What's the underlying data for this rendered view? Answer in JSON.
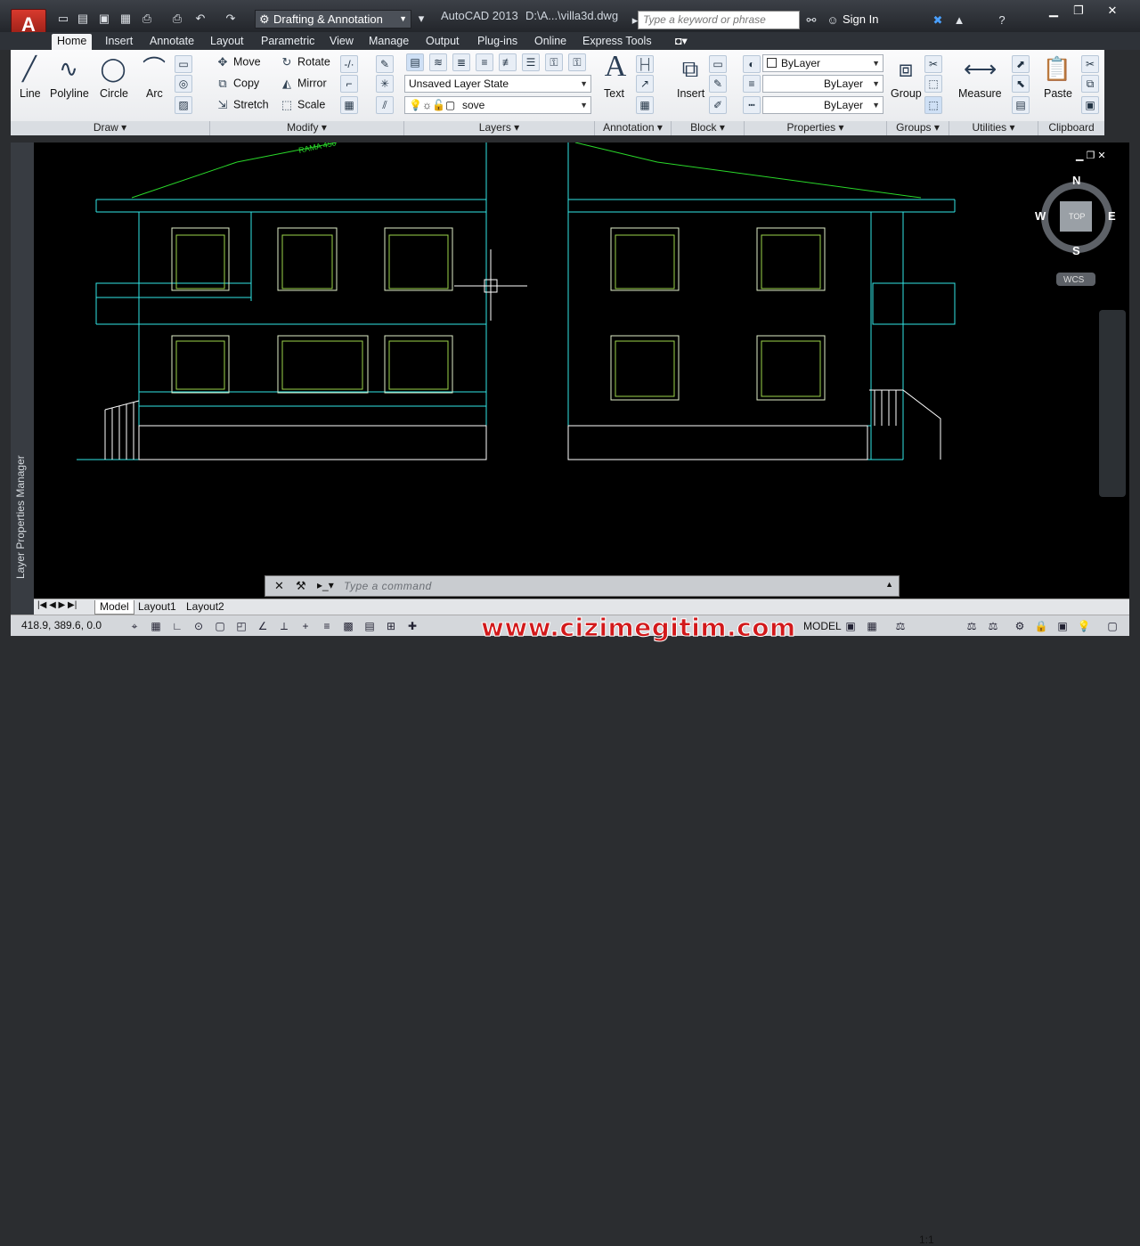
{
  "app": {
    "logo": "A",
    "title": "AutoCAD 2013",
    "file": "D:\\A...\\villa3d.dwg"
  },
  "workspace": "Drafting & Annotation",
  "search": {
    "placeholder": "Type a keyword or phrase"
  },
  "signin": "Sign In",
  "tabs": [
    "Home",
    "Insert",
    "Annotate",
    "Layout",
    "Parametric",
    "View",
    "Manage",
    "Output",
    "Plug-ins",
    "Online",
    "Express Tools"
  ],
  "draw": {
    "line": "Line",
    "polyline": "Polyline",
    "circle": "Circle",
    "arc": "Arc",
    "title": "Draw"
  },
  "modify": {
    "move": "Move",
    "rotate": "Rotate",
    "copy": "Copy",
    "mirror": "Mirror",
    "stretch": "Stretch",
    "scale": "Scale",
    "title": "Modify"
  },
  "layers": {
    "state": "Unsaved Layer State",
    "current": "sove",
    "title": "Layers"
  },
  "annotation": {
    "text": "Text",
    "title": "Annotation"
  },
  "block": {
    "insert": "Insert",
    "title": "Block"
  },
  "properties": {
    "color": "ByLayer",
    "linetype": "ByLayer",
    "lineweight": "ByLayer",
    "title": "Properties"
  },
  "groups": {
    "group": "Group",
    "title": "Groups"
  },
  "utilities": {
    "measure": "Measure",
    "title": "Utilities"
  },
  "clipboard": {
    "paste": "Paste",
    "title": "Clipboard"
  },
  "sidepalette": "Layer Properties Manager",
  "viewcube": {
    "n": "N",
    "s": "S",
    "e": "E",
    "w": "W",
    "top": "TOP",
    "wcs": "WCS"
  },
  "command": {
    "placeholder": "Type a command"
  },
  "layouts": [
    "Model",
    "Layout1",
    "Layout2"
  ],
  "status": {
    "coords": "418.9, 389.6, 0.0",
    "model": "MODEL",
    "scale": "1:1"
  },
  "watermark": "www.cizimegitim.com",
  "canvas_text": "RAMA 450"
}
